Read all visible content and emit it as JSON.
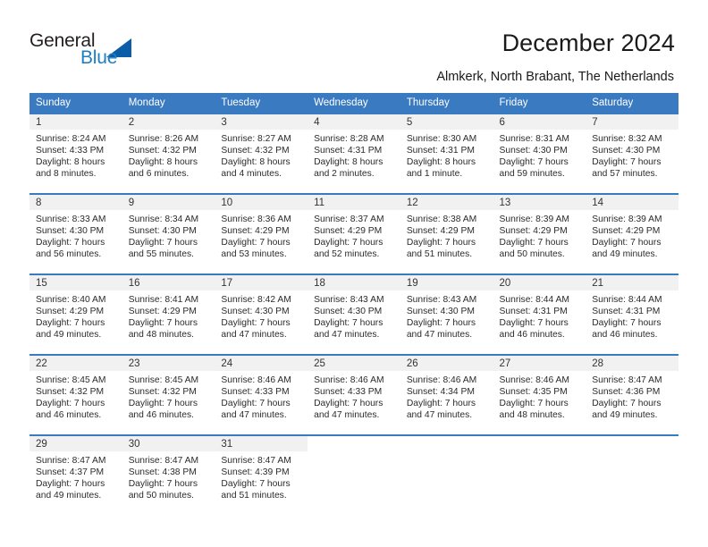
{
  "brand": {
    "name_part1": "General",
    "name_part2": "Blue",
    "triangle_color": "#0c5ca8",
    "blue_text_color": "#1f7fc4"
  },
  "header": {
    "title": "December 2024",
    "subtitle": "Almkerk, North Brabant, The Netherlands",
    "header_bg_color": "#3a7ac0",
    "daynum_bg_color": "#f1f1f1"
  },
  "weekday_headers": [
    "Sunday",
    "Monday",
    "Tuesday",
    "Wednesday",
    "Thursday",
    "Friday",
    "Saturday"
  ],
  "weeks": [
    [
      {
        "day": "1",
        "sunrise": "Sunrise: 8:24 AM",
        "sunset": "Sunset: 4:33 PM",
        "daylight_line1": "Daylight: 8 hours",
        "daylight_line2": "and 8 minutes."
      },
      {
        "day": "2",
        "sunrise": "Sunrise: 8:26 AM",
        "sunset": "Sunset: 4:32 PM",
        "daylight_line1": "Daylight: 8 hours",
        "daylight_line2": "and 6 minutes."
      },
      {
        "day": "3",
        "sunrise": "Sunrise: 8:27 AM",
        "sunset": "Sunset: 4:32 PM",
        "daylight_line1": "Daylight: 8 hours",
        "daylight_line2": "and 4 minutes."
      },
      {
        "day": "4",
        "sunrise": "Sunrise: 8:28 AM",
        "sunset": "Sunset: 4:31 PM",
        "daylight_line1": "Daylight: 8 hours",
        "daylight_line2": "and 2 minutes."
      },
      {
        "day": "5",
        "sunrise": "Sunrise: 8:30 AM",
        "sunset": "Sunset: 4:31 PM",
        "daylight_line1": "Daylight: 8 hours",
        "daylight_line2": "and 1 minute."
      },
      {
        "day": "6",
        "sunrise": "Sunrise: 8:31 AM",
        "sunset": "Sunset: 4:30 PM",
        "daylight_line1": "Daylight: 7 hours",
        "daylight_line2": "and 59 minutes."
      },
      {
        "day": "7",
        "sunrise": "Sunrise: 8:32 AM",
        "sunset": "Sunset: 4:30 PM",
        "daylight_line1": "Daylight: 7 hours",
        "daylight_line2": "and 57 minutes."
      }
    ],
    [
      {
        "day": "8",
        "sunrise": "Sunrise: 8:33 AM",
        "sunset": "Sunset: 4:30 PM",
        "daylight_line1": "Daylight: 7 hours",
        "daylight_line2": "and 56 minutes."
      },
      {
        "day": "9",
        "sunrise": "Sunrise: 8:34 AM",
        "sunset": "Sunset: 4:30 PM",
        "daylight_line1": "Daylight: 7 hours",
        "daylight_line2": "and 55 minutes."
      },
      {
        "day": "10",
        "sunrise": "Sunrise: 8:36 AM",
        "sunset": "Sunset: 4:29 PM",
        "daylight_line1": "Daylight: 7 hours",
        "daylight_line2": "and 53 minutes."
      },
      {
        "day": "11",
        "sunrise": "Sunrise: 8:37 AM",
        "sunset": "Sunset: 4:29 PM",
        "daylight_line1": "Daylight: 7 hours",
        "daylight_line2": "and 52 minutes."
      },
      {
        "day": "12",
        "sunrise": "Sunrise: 8:38 AM",
        "sunset": "Sunset: 4:29 PM",
        "daylight_line1": "Daylight: 7 hours",
        "daylight_line2": "and 51 minutes."
      },
      {
        "day": "13",
        "sunrise": "Sunrise: 8:39 AM",
        "sunset": "Sunset: 4:29 PM",
        "daylight_line1": "Daylight: 7 hours",
        "daylight_line2": "and 50 minutes."
      },
      {
        "day": "14",
        "sunrise": "Sunrise: 8:39 AM",
        "sunset": "Sunset: 4:29 PM",
        "daylight_line1": "Daylight: 7 hours",
        "daylight_line2": "and 49 minutes."
      }
    ],
    [
      {
        "day": "15",
        "sunrise": "Sunrise: 8:40 AM",
        "sunset": "Sunset: 4:29 PM",
        "daylight_line1": "Daylight: 7 hours",
        "daylight_line2": "and 49 minutes."
      },
      {
        "day": "16",
        "sunrise": "Sunrise: 8:41 AM",
        "sunset": "Sunset: 4:29 PM",
        "daylight_line1": "Daylight: 7 hours",
        "daylight_line2": "and 48 minutes."
      },
      {
        "day": "17",
        "sunrise": "Sunrise: 8:42 AM",
        "sunset": "Sunset: 4:30 PM",
        "daylight_line1": "Daylight: 7 hours",
        "daylight_line2": "and 47 minutes."
      },
      {
        "day": "18",
        "sunrise": "Sunrise: 8:43 AM",
        "sunset": "Sunset: 4:30 PM",
        "daylight_line1": "Daylight: 7 hours",
        "daylight_line2": "and 47 minutes."
      },
      {
        "day": "19",
        "sunrise": "Sunrise: 8:43 AM",
        "sunset": "Sunset: 4:30 PM",
        "daylight_line1": "Daylight: 7 hours",
        "daylight_line2": "and 47 minutes."
      },
      {
        "day": "20",
        "sunrise": "Sunrise: 8:44 AM",
        "sunset": "Sunset: 4:31 PM",
        "daylight_line1": "Daylight: 7 hours",
        "daylight_line2": "and 46 minutes."
      },
      {
        "day": "21",
        "sunrise": "Sunrise: 8:44 AM",
        "sunset": "Sunset: 4:31 PM",
        "daylight_line1": "Daylight: 7 hours",
        "daylight_line2": "and 46 minutes."
      }
    ],
    [
      {
        "day": "22",
        "sunrise": "Sunrise: 8:45 AM",
        "sunset": "Sunset: 4:32 PM",
        "daylight_line1": "Daylight: 7 hours",
        "daylight_line2": "and 46 minutes."
      },
      {
        "day": "23",
        "sunrise": "Sunrise: 8:45 AM",
        "sunset": "Sunset: 4:32 PM",
        "daylight_line1": "Daylight: 7 hours",
        "daylight_line2": "and 46 minutes."
      },
      {
        "day": "24",
        "sunrise": "Sunrise: 8:46 AM",
        "sunset": "Sunset: 4:33 PM",
        "daylight_line1": "Daylight: 7 hours",
        "daylight_line2": "and 47 minutes."
      },
      {
        "day": "25",
        "sunrise": "Sunrise: 8:46 AM",
        "sunset": "Sunset: 4:33 PM",
        "daylight_line1": "Daylight: 7 hours",
        "daylight_line2": "and 47 minutes."
      },
      {
        "day": "26",
        "sunrise": "Sunrise: 8:46 AM",
        "sunset": "Sunset: 4:34 PM",
        "daylight_line1": "Daylight: 7 hours",
        "daylight_line2": "and 47 minutes."
      },
      {
        "day": "27",
        "sunrise": "Sunrise: 8:46 AM",
        "sunset": "Sunset: 4:35 PM",
        "daylight_line1": "Daylight: 7 hours",
        "daylight_line2": "and 48 minutes."
      },
      {
        "day": "28",
        "sunrise": "Sunrise: 8:47 AM",
        "sunset": "Sunset: 4:36 PM",
        "daylight_line1": "Daylight: 7 hours",
        "daylight_line2": "and 49 minutes."
      }
    ],
    [
      {
        "day": "29",
        "sunrise": "Sunrise: 8:47 AM",
        "sunset": "Sunset: 4:37 PM",
        "daylight_line1": "Daylight: 7 hours",
        "daylight_line2": "and 49 minutes."
      },
      {
        "day": "30",
        "sunrise": "Sunrise: 8:47 AM",
        "sunset": "Sunset: 4:38 PM",
        "daylight_line1": "Daylight: 7 hours",
        "daylight_line2": "and 50 minutes."
      },
      {
        "day": "31",
        "sunrise": "Sunrise: 8:47 AM",
        "sunset": "Sunset: 4:39 PM",
        "daylight_line1": "Daylight: 7 hours",
        "daylight_line2": "and 51 minutes."
      },
      {
        "day": "",
        "sunrise": "",
        "sunset": "",
        "daylight_line1": "",
        "daylight_line2": ""
      },
      {
        "day": "",
        "sunrise": "",
        "sunset": "",
        "daylight_line1": "",
        "daylight_line2": ""
      },
      {
        "day": "",
        "sunrise": "",
        "sunset": "",
        "daylight_line1": "",
        "daylight_line2": ""
      },
      {
        "day": "",
        "sunrise": "",
        "sunset": "",
        "daylight_line1": "",
        "daylight_line2": ""
      }
    ]
  ]
}
